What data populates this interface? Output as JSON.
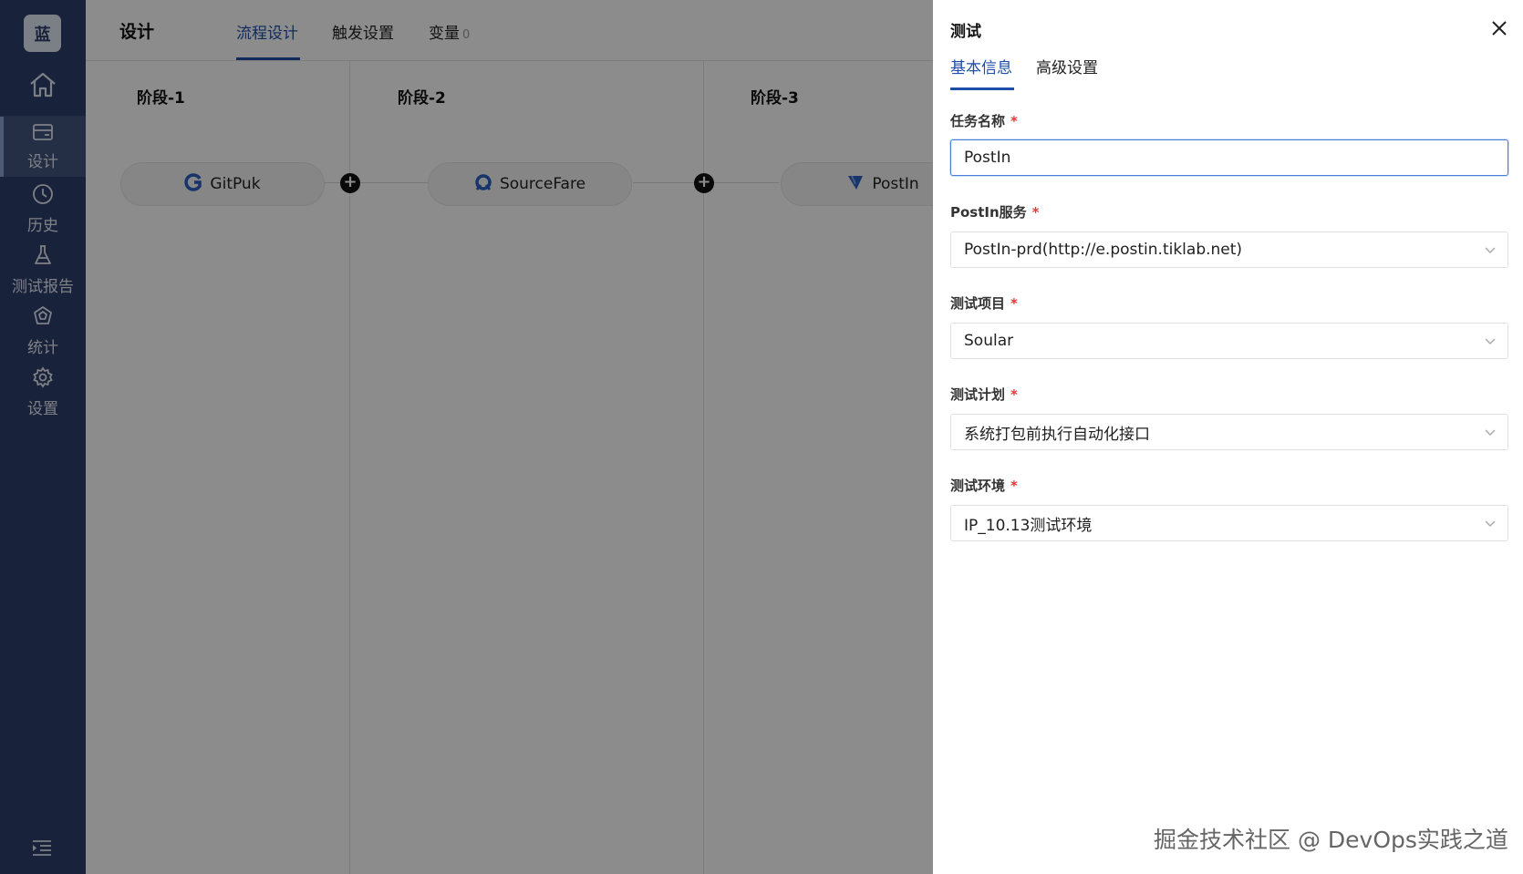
{
  "sidebar": {
    "logo_text": "蓝",
    "home_icon": "home-icon",
    "items": [
      {
        "label": "设计",
        "icon": "credit-card-icon",
        "active": true
      },
      {
        "label": "历史",
        "icon": "clock-icon",
        "active": false
      },
      {
        "label": "测试报告",
        "icon": "flask-icon",
        "active": false
      },
      {
        "label": "统计",
        "icon": "chart-badge-icon",
        "active": false
      },
      {
        "label": "设置",
        "icon": "gear-icon",
        "active": false
      }
    ],
    "collapse_icon": "menu-indent-icon"
  },
  "header": {
    "title": "设计",
    "tabs": [
      {
        "label": "流程设计",
        "active": true
      },
      {
        "label": "触发设置",
        "active": false
      },
      {
        "label": "变量",
        "count": "0",
        "active": false
      }
    ]
  },
  "pipeline": {
    "stages": [
      {
        "title": "阶段-1",
        "node": "GitPuk",
        "icon": "gitpuk-icon"
      },
      {
        "title": "阶段-2",
        "node": "SourceFare",
        "icon": "sourcefare-icon"
      },
      {
        "title": "阶段-3",
        "node": "PostIn",
        "icon": "postin-icon"
      }
    ]
  },
  "drawer": {
    "title": "测试",
    "close_icon": "close-icon",
    "tabs": [
      {
        "label": "基本信息",
        "active": true
      },
      {
        "label": "高级设置",
        "active": false
      }
    ],
    "fields": [
      {
        "label": "任务名称",
        "required": "*",
        "value": "PostIn",
        "type": "input"
      },
      {
        "label": "PostIn服务",
        "required": "*",
        "value": "PostIn-prd(http://e.postin.tiklab.net)",
        "type": "select"
      },
      {
        "label": "测试项目",
        "required": "*",
        "value": "Soular",
        "type": "select"
      },
      {
        "label": "测试计划",
        "required": "*",
        "value": "系统打包前执行自动化接口",
        "type": "select"
      },
      {
        "label": "测试环境",
        "required": "*",
        "value": "IP_10.13测试环境",
        "type": "select"
      }
    ]
  },
  "watermark": "掘金技术社区 @ DevOps实践之道",
  "colors": {
    "sidebar_bg": "#2c3f6b",
    "accent": "#1e4ea8",
    "required": "#e03b3b"
  }
}
